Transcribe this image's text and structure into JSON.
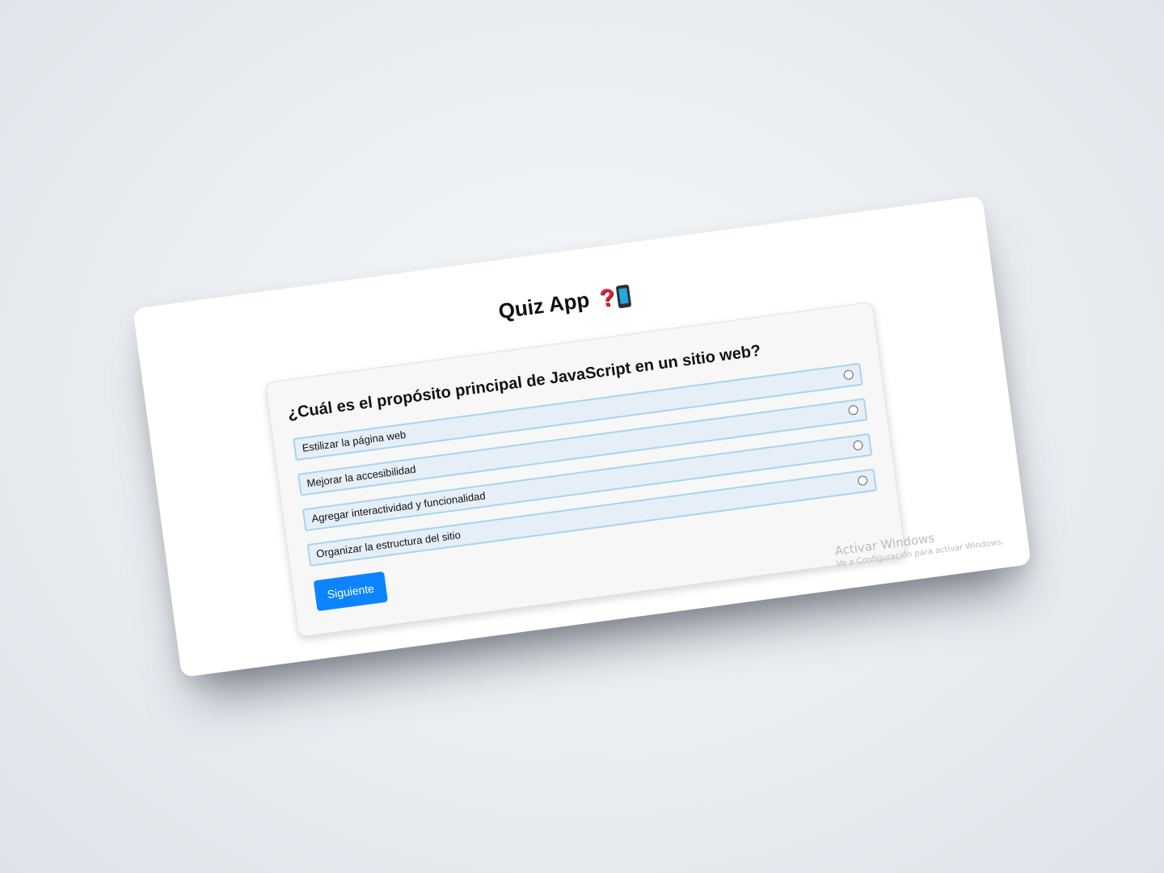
{
  "app": {
    "title": "Quiz App"
  },
  "icons": {
    "title_icons": [
      "question-mark-icon",
      "mobile-phone-icon"
    ],
    "question_mark_color": "#d7263d",
    "phone_screen_color": "#23a8e0"
  },
  "quiz": {
    "question": "¿Cuál es el propósito principal de JavaScript en un sitio web?",
    "options": [
      {
        "label": "Estilizar la página web",
        "selected": false
      },
      {
        "label": "Mejorar la accesibilidad",
        "selected": false
      },
      {
        "label": "Agregar interactividad y funcionalidad",
        "selected": false
      },
      {
        "label": "Organizar la estructura del sitio",
        "selected": false
      }
    ],
    "next_label": "Siguiente"
  },
  "colors": {
    "accent": "#0d84ff",
    "option_background": "#e6eff8",
    "option_border": "#a8d4ee",
    "card_background": "#f7f7f7"
  },
  "watermark": {
    "title": "Activar Windows",
    "subtitle": "Ve a Configuración para activar Windows."
  }
}
